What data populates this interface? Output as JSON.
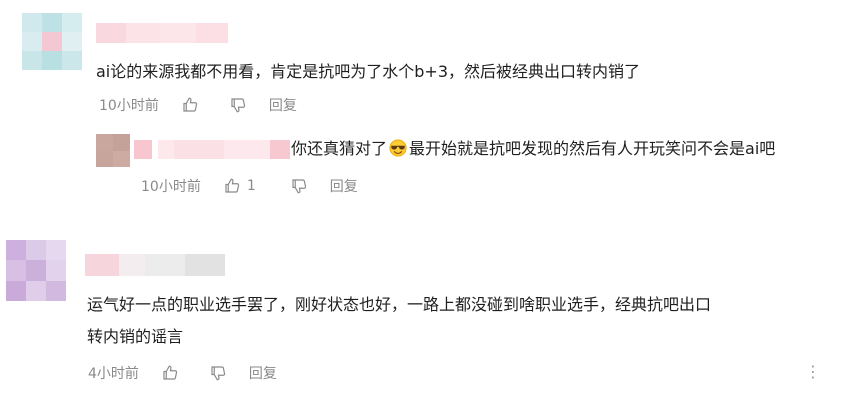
{
  "comments": [
    {
      "text": "ai论的来源我都不用看，肯定是抗吧为了水个b+3，然后被经典出口转内销了",
      "time": "10小时前",
      "likes": "",
      "reply_label": "回复",
      "reply": {
        "text_before": "你还真猜对了",
        "emoji": "grinning-face-with-sunglasses",
        "text_after": "最开始就是抗吧发现的然后有人开玩笑问不会是ai吧",
        "time": "10小时前",
        "likes": "1",
        "reply_label": "回复"
      }
    },
    {
      "text_line1": "运气好一点的职业选手罢了，刚好状态也好，一路上都没碰到啥职业选手，经典抗吧出口",
      "text_line2": "转内销的谣言",
      "time": "4小时前",
      "likes": "",
      "reply_label": "回复",
      "more_label": "⋮"
    }
  ],
  "colors": {
    "meta_gray": "#8a8a8a",
    "avatar1": [
      "#f2cfd6",
      "#bfe3e6",
      "#d7ecef"
    ],
    "avatar2": [
      "#cdb3dc",
      "#e4d4ec",
      "#d9c4e4"
    ],
    "avatar3": [
      "#c9a79f",
      "#d9bcb5"
    ]
  }
}
